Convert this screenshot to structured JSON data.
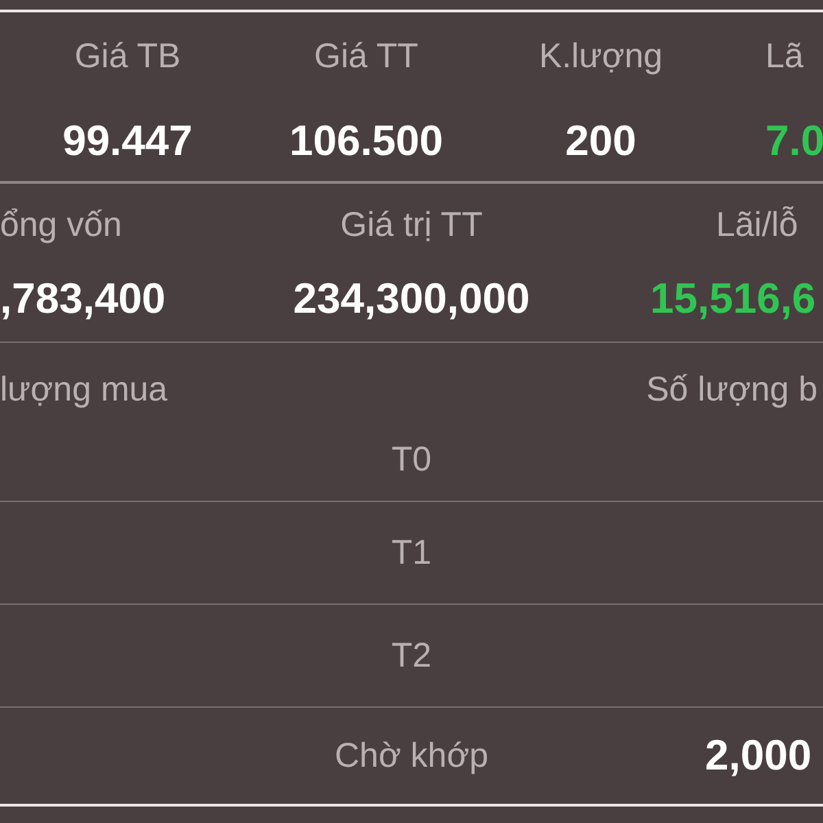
{
  "position_summary": {
    "columns": [
      {
        "label": "Giá TB",
        "value": "99.447",
        "color": "#ffffff"
      },
      {
        "label": "Giá TT",
        "value": "106.500",
        "color": "#ffffff"
      },
      {
        "label": "K.lượng",
        "value": "200",
        "color": "#ffffff"
      },
      {
        "label": "Lã",
        "value": "7.0",
        "color": "#30c552"
      }
    ]
  },
  "value_summary": {
    "columns": [
      {
        "label": "ổng vốn",
        "value": ",783,400",
        "color": "#ffffff"
      },
      {
        "label": "Giá trị TT",
        "value": "234,300,000",
        "color": "#ffffff"
      },
      {
        "label": "Lãi/lỗ",
        "value": "15,516,6",
        "color": "#30c552"
      }
    ]
  },
  "order_table": {
    "headers": [
      "lượng mua",
      "Số lượng b"
    ],
    "rows": [
      {
        "label": "T0"
      },
      {
        "label": "T1"
      },
      {
        "label": "T2"
      },
      {
        "label": "Chờ khớp",
        "column_3": "2,000"
      }
    ]
  }
}
